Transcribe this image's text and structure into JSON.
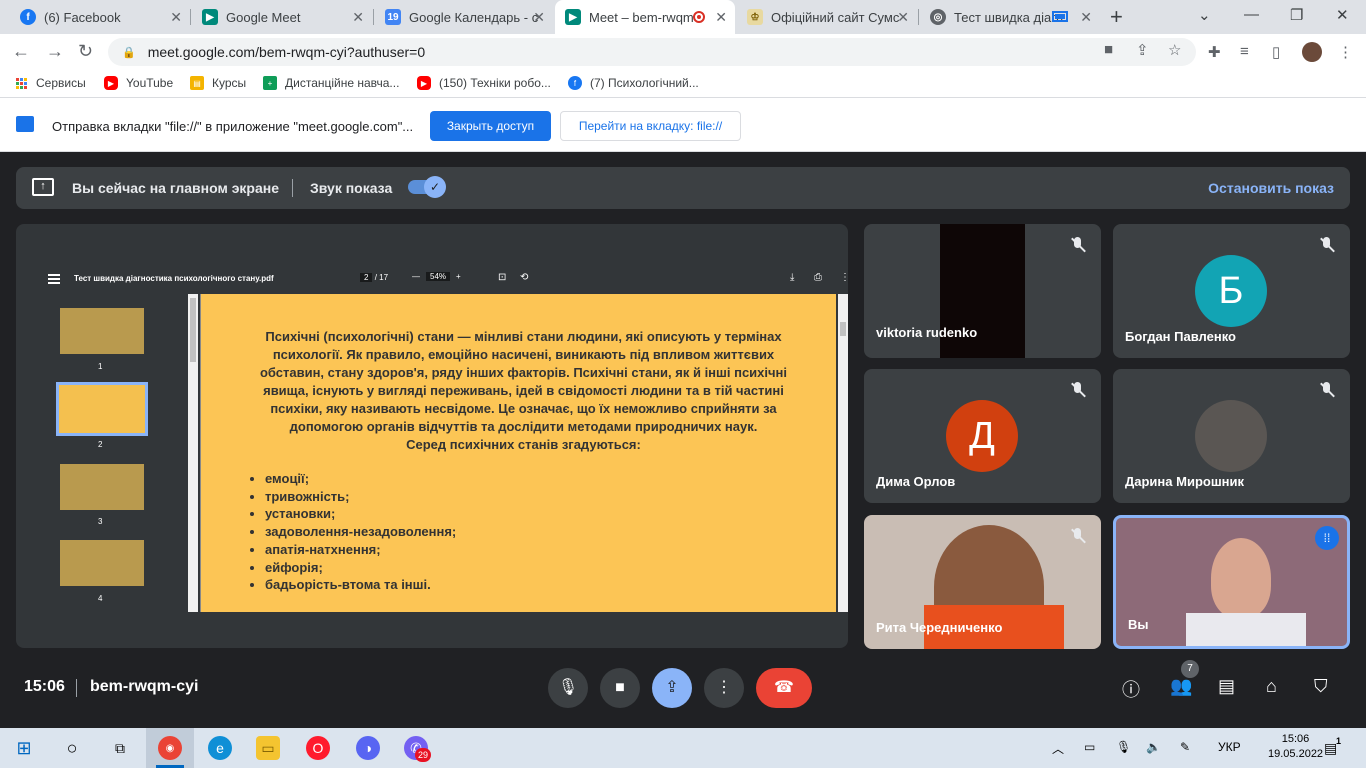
{
  "browser": {
    "tabs": [
      {
        "title": "(6) Facebook",
        "icon": "facebook-icon",
        "color": "#1877f2"
      },
      {
        "title": "Google Meet",
        "icon": "meet-icon",
        "color": "#00897b"
      },
      {
        "title": "Google Календарь - с",
        "icon": "calendar-icon",
        "color": "#4285f4"
      },
      {
        "title": "Meet – bem-rwqm",
        "icon": "meet-icon",
        "color": "#00897b"
      },
      {
        "title": "Офіційний сайт Сумс",
        "icon": "crest-icon",
        "color": "#c9a227"
      },
      {
        "title": "Тест швидка діагн",
        "icon": "globe-icon",
        "color": "#5f6368"
      }
    ],
    "url": "meet.google.com/bem-rwqm-cyi?authuser=0",
    "bookmarks": [
      {
        "label": "Сервисы",
        "icon": "apps-grid-icon",
        "color": "#ea4335"
      },
      {
        "label": "YouTube",
        "icon": "youtube-icon",
        "color": "#ff0000"
      },
      {
        "label": "Курсы",
        "icon": "courses-icon",
        "color": "#f4b400"
      },
      {
        "label": "Дистанційне навча...",
        "icon": "classroom-icon",
        "color": "#0f9d58"
      },
      {
        "label": "(150) Техніки робо...",
        "icon": "youtube-icon",
        "color": "#ff0000"
      },
      {
        "label": "(7) Психологічний...",
        "icon": "facebook-icon",
        "color": "#1877f2"
      }
    ],
    "infobar": {
      "message": "Отправка вкладки \"file://\" в приложение \"meet.google.com\"...",
      "primary": "Закрыть доступ",
      "secondary": "Перейти на вкладку: file://"
    }
  },
  "meet": {
    "present_bar": {
      "title": "Вы сейчас на главном экране",
      "sound_label": "Звук показа",
      "sound_on": true,
      "stop": "Остановить показ"
    },
    "pdf": {
      "filename": "Тест швидка діагностика психологічного стану.pdf",
      "page": "2",
      "total": "/ 17",
      "zoom": "54%",
      "thumb_labels": [
        "1",
        "2",
        "3",
        "4"
      ],
      "paragraph": "Психічні (психологічні) стани — мінливі стани людини, які описують у термінах психології. Як правило, емоційно насичені, виникають під впливом життєвих обставин, стану здоров'я, ряду інших факторів. Психічні стани, як й інші психічні явища, існують у вигляді переживань, ідей в свідомості людини та в тій частині психіки, яку називають несвідоме. Це означає, що їх неможливо сприйняти за допомогою органів відчуттів та дослідити методами природничих наук.",
      "subheading": "Серед психічних станів згадуються:",
      "items": [
        "емоції;",
        "тривожність;",
        "установки;",
        "задоволення-незадоволення;",
        "апатія-натхнення;",
        "ейфорія;",
        "бадьорість-втома та інші."
      ]
    },
    "participants": [
      {
        "name": "viktoria rudenko",
        "muted": true
      },
      {
        "name": "Богдан Павленко",
        "initial": "Б",
        "color": "#12a4b4",
        "muted": true
      },
      {
        "name": "Дима Орлов",
        "initial": "Д",
        "color": "#d1400f",
        "muted": true
      },
      {
        "name": "Дарина Мирошник",
        "muted": true
      },
      {
        "name": "Рита Чередниченко",
        "muted": true
      },
      {
        "name": "Вы",
        "speaking": true
      }
    ],
    "bottom": {
      "time": "15:06",
      "meeting_code": "bem-rwqm-cyi",
      "people_count": "7"
    }
  },
  "taskbar": {
    "lang": "УКР",
    "time": "15:06",
    "date": "19.05.2022",
    "viber_badge": "29",
    "notif": "1"
  }
}
